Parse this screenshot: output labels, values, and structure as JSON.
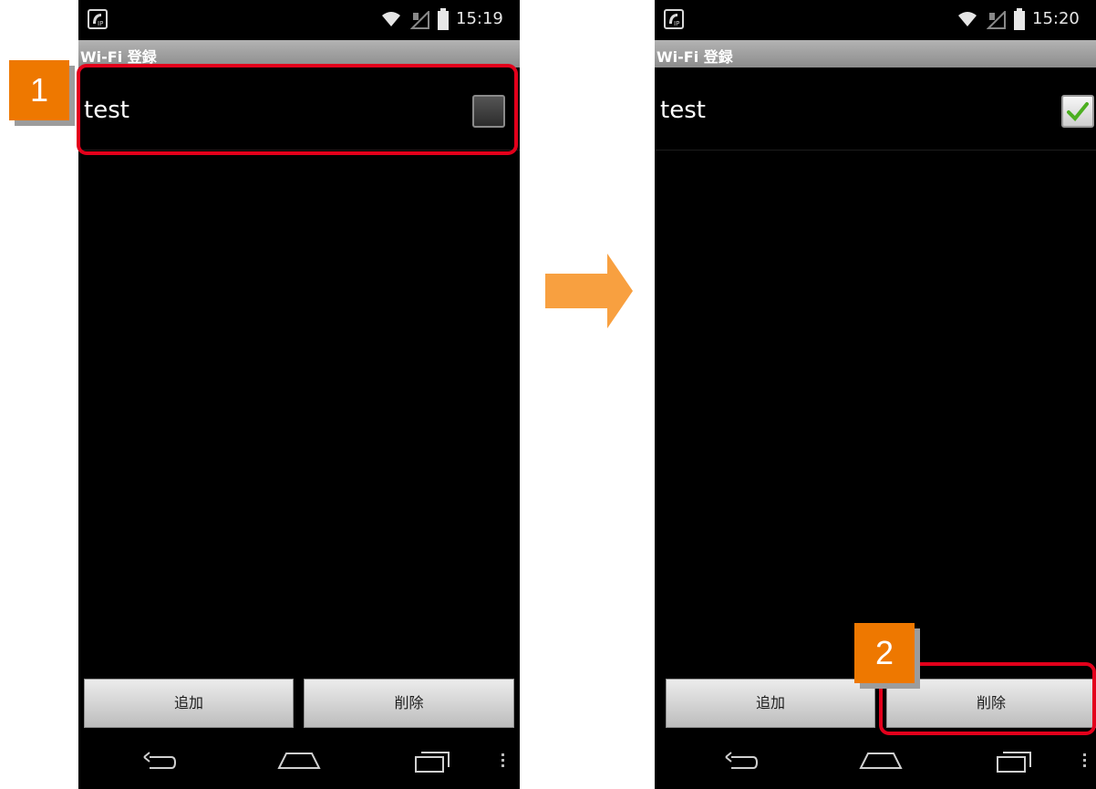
{
  "colors": {
    "accent_orange": "#ee7800",
    "highlight_red": "#e3001b",
    "check_green": "#4caf20"
  },
  "screens": [
    {
      "status": {
        "time": "15:19"
      },
      "title": "Wi-Fi 登録",
      "list": [
        {
          "label": "test",
          "checked": false
        }
      ],
      "buttons": {
        "add": "追加",
        "delete": "削除"
      },
      "step": "1"
    },
    {
      "status": {
        "time": "15:20"
      },
      "title": "Wi-Fi 登録",
      "list": [
        {
          "label": "test",
          "checked": true
        }
      ],
      "buttons": {
        "add": "追加",
        "delete": "削除"
      },
      "step": "2"
    }
  ],
  "icons": {
    "status": [
      "app-icon",
      "wifi-icon",
      "sim-icon",
      "battery-icon"
    ],
    "nav": [
      "back-icon",
      "home-icon",
      "recents-icon",
      "menu-icon"
    ],
    "transition": "arrow-right-icon"
  }
}
